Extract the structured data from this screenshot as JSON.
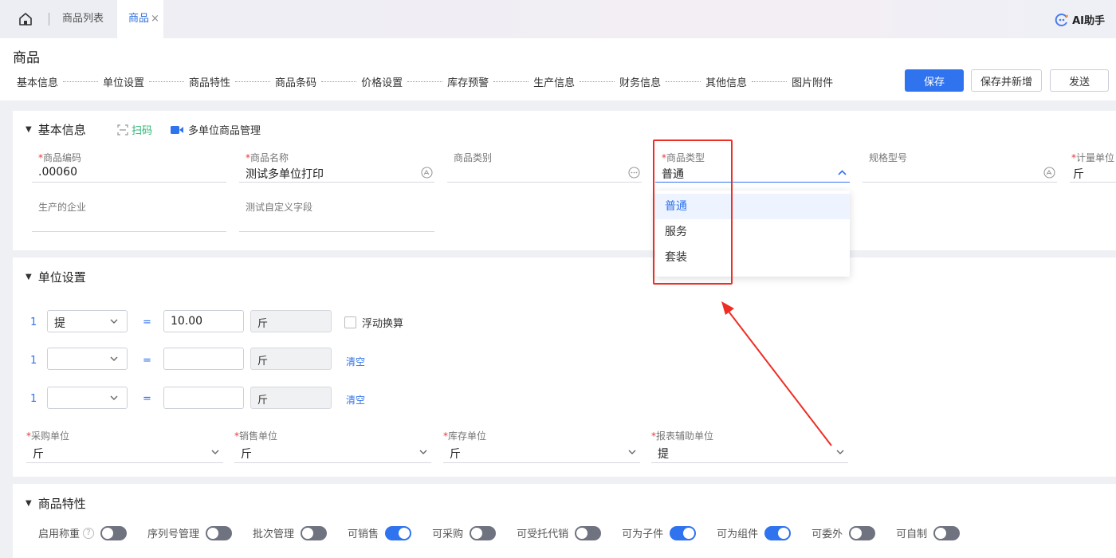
{
  "topbar": {
    "tabs": [
      {
        "label": "商品列表"
      },
      {
        "label": "商品",
        "close": "×"
      }
    ],
    "ai_helper": "AI助手"
  },
  "header": {
    "title": "商品",
    "steps": [
      "基本信息",
      "单位设置",
      "商品特性",
      "商品条码",
      "价格设置",
      "库存预警",
      "生产信息",
      "财务信息",
      "其他信息",
      "图片附件"
    ],
    "buttons": {
      "save": "保存",
      "save_new": "保存并新增",
      "send": "发送"
    }
  },
  "basic": {
    "title": "基本信息",
    "scan": "扫码",
    "multi_unit": "多单位商品管理",
    "fields": {
      "code": {
        "required": "*",
        "label": "商品编码",
        "value": ".00060"
      },
      "name": {
        "required": "*",
        "label": "商品名称",
        "value": "测试多单位打印"
      },
      "category": {
        "label": "商品类别",
        "value": ""
      },
      "type": {
        "required": "*",
        "label": "商品类型",
        "value": "普通"
      },
      "spec": {
        "label": "规格型号",
        "value": ""
      },
      "unit": {
        "required": "*",
        "label": "计量单位",
        "value": "斤"
      },
      "maker": {
        "label": "生产的企业",
        "value": ""
      },
      "custom": {
        "label": "测试自定义字段",
        "value": ""
      }
    },
    "type_options": [
      "普通",
      "服务",
      "套装"
    ]
  },
  "units": {
    "title": "单位设置",
    "rows": [
      {
        "num": "1",
        "unit": "提",
        "eq": "=",
        "qty": "10.00",
        "base": "斤",
        "extra": "浮动换算"
      },
      {
        "num": "1",
        "unit": "",
        "eq": "=",
        "qty": "",
        "base": "斤",
        "extra": "清空"
      },
      {
        "num": "1",
        "unit": "",
        "eq": "=",
        "qty": "",
        "base": "斤",
        "extra": "清空"
      }
    ],
    "fields": [
      {
        "required": "*",
        "label": "采购单位",
        "value": "斤"
      },
      {
        "required": "*",
        "label": "销售单位",
        "value": "斤"
      },
      {
        "required": "*",
        "label": "库存单位",
        "value": "斤"
      },
      {
        "required": "*",
        "label": "报表辅助单位",
        "value": "提"
      }
    ]
  },
  "features": {
    "title": "商品特性",
    "switches": [
      {
        "label": "启用称重",
        "help": "?",
        "on": false
      },
      {
        "label": "序列号管理",
        "on": false
      },
      {
        "label": "批次管理",
        "on": false
      },
      {
        "label": "可销售",
        "on": true
      },
      {
        "label": "可采购",
        "on": false
      },
      {
        "label": "可受托代销",
        "on": false
      },
      {
        "label": "可为子件",
        "on": true
      },
      {
        "label": "可为组件",
        "on": true
      },
      {
        "label": "可委外",
        "on": false
      },
      {
        "label": "可自制",
        "on": false
      }
    ]
  },
  "colors": {
    "primary": "#2f73ee",
    "required": "#e03a3a",
    "annotation": "#ee2e24",
    "scan": "#2bb673"
  }
}
